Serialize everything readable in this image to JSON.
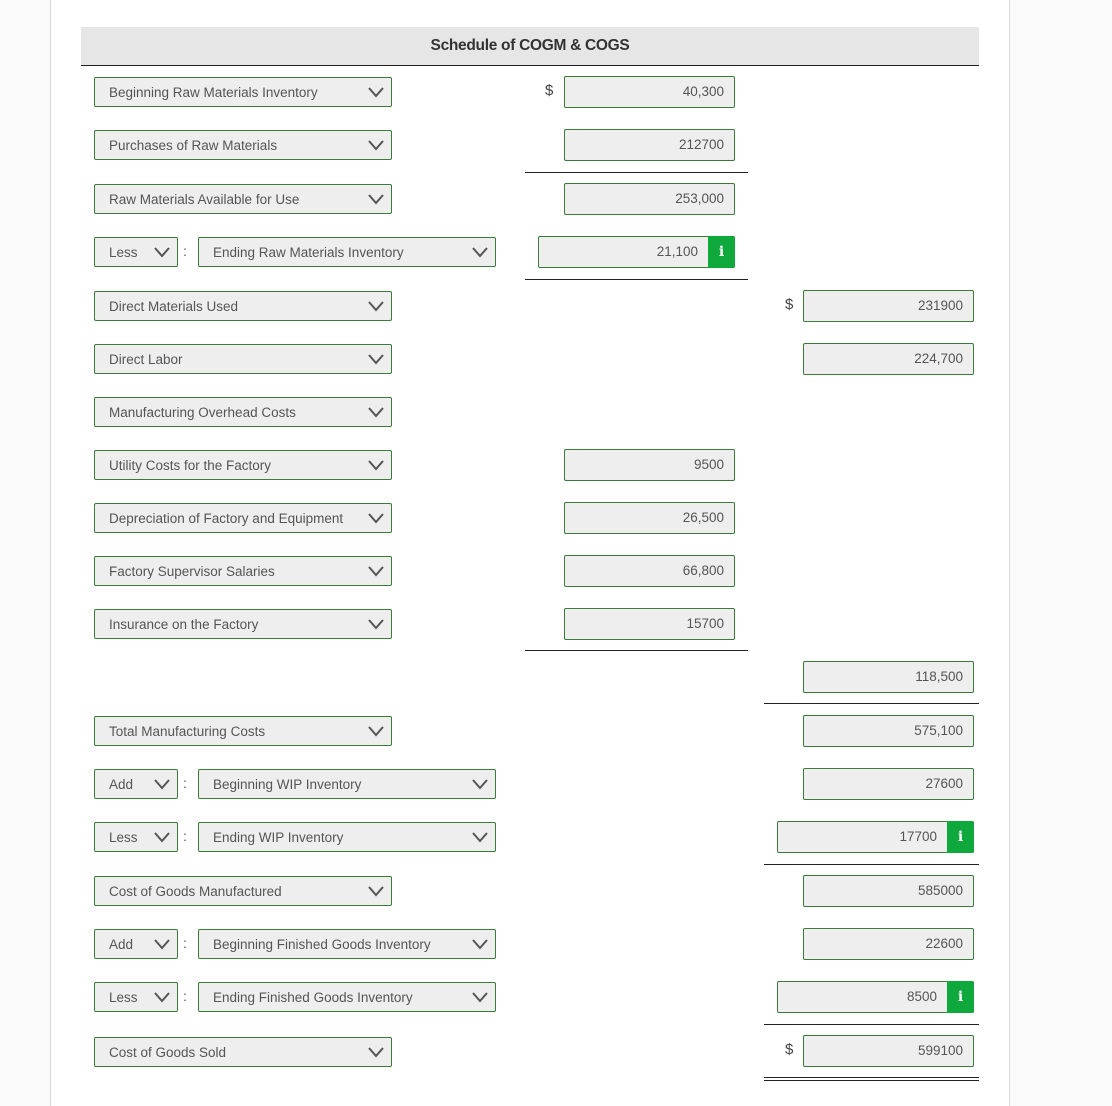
{
  "header": {
    "title": "Schedule of COGM & COGS"
  },
  "currency_symbol": "$",
  "info_glyph": "i",
  "rows": {
    "beg_rm": {
      "label": "Beginning Raw Materials Inventory",
      "value": "40,300"
    },
    "purch_rm": {
      "label": "Purchases of Raw Materials",
      "value": "212700"
    },
    "rm_avail": {
      "label": "Raw Materials Available for Use",
      "value": "253,000"
    },
    "end_rm": {
      "operator": "Less",
      "label": "Ending Raw Materials Inventory",
      "value": "21,100"
    },
    "dm_used": {
      "label": "Direct Materials Used",
      "value": "231900"
    },
    "dl": {
      "label": "Direct Labor",
      "value": "224,700"
    },
    "moh": {
      "label": "Manufacturing Overhead Costs"
    },
    "utility": {
      "label": "Utility Costs for the Factory",
      "value": "9500"
    },
    "deprec": {
      "label": "Depreciation of Factory and Equipment",
      "value": "26,500"
    },
    "superv": {
      "label": "Factory Supervisor Salaries",
      "value": "66,800"
    },
    "insur": {
      "label": "Insurance on the Factory",
      "value": "15700"
    },
    "moh_total": {
      "value": "118,500"
    },
    "tmc": {
      "label": "Total Manufacturing Costs",
      "value": "575,100"
    },
    "beg_wip": {
      "operator": "Add",
      "label": "Beginning WIP Inventory",
      "value": "27600"
    },
    "end_wip": {
      "operator": "Less",
      "label": "Ending WIP Inventory",
      "value": "17700"
    },
    "cogm": {
      "label": "Cost of Goods Manufactured",
      "value": "585000"
    },
    "beg_fg": {
      "operator": "Add",
      "label": "Beginning Finished Goods Inventory",
      "value": "22600"
    },
    "end_fg": {
      "operator": "Less",
      "label": "Ending Finished Goods Inventory",
      "value": "8500"
    },
    "cogs": {
      "label": "Cost of Goods Sold",
      "value": "599100"
    }
  }
}
